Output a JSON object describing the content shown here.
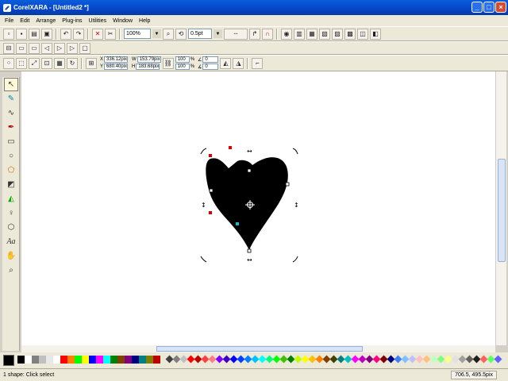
{
  "window": {
    "title": "CorelXARA - [Untitled2 *]",
    "controls": [
      "_",
      "□",
      "×"
    ]
  },
  "menu": [
    "File",
    "Edit",
    "Arrange",
    "Plug-ins",
    "Utilities",
    "Window",
    "Help"
  ],
  "toolbar1": {
    "zoom": "100%",
    "line_width": "0.5pt"
  },
  "toolbar2": {
    "x": "336.12pix",
    "y": "680.40pix",
    "w": "153.79pix",
    "h": "183.68pix",
    "scale_w": "100",
    "scale_h": "100",
    "rotate": "0",
    "skew": "0"
  },
  "status": {
    "message": "1 shape: Click select",
    "coords": "706.5, 495.5pix"
  },
  "colors": {
    "palette": [
      "#000000",
      "#ffffff",
      "#808080",
      "#c0c0c0",
      "#e8e8e8",
      "#ffffff",
      "#ff0000",
      "#ff8000",
      "#00ff00",
      "#ffff00",
      "#0000ff",
      "#ff00ff",
      "#00ffff",
      "#008000",
      "#804000",
      "#800080",
      "#000080",
      "#008080",
      "#808000",
      "#c00000"
    ],
    "diamonds": [
      "#404040",
      "#808080",
      "#c0c0c0",
      "#ff0000",
      "#c00000",
      "#ff4040",
      "#ff8080",
      "#8000ff",
      "#4000c0",
      "#0000ff",
      "#0040ff",
      "#0080ff",
      "#00c0ff",
      "#00ffff",
      "#00ff80",
      "#00ff00",
      "#40c000",
      "#008000",
      "#c0ff00",
      "#ffff00",
      "#ffc000",
      "#ff8000",
      "#804000",
      "#404000",
      "#008080",
      "#00c0c0",
      "#ff00ff",
      "#c000c0",
      "#800080",
      "#ff0080",
      "#800000",
      "#000080",
      "#4080ff",
      "#80c0ff",
      "#c0c0ff",
      "#ffc0c0",
      "#ffc080",
      "#c0ffc0",
      "#80ff80",
      "#ffff80",
      "#e0e0e0",
      "#a0a0a0",
      "#606060",
      "#202020",
      "#ff6060",
      "#60ff60",
      "#6060ff",
      "#ffa0ff",
      "#a0ffff"
    ]
  }
}
